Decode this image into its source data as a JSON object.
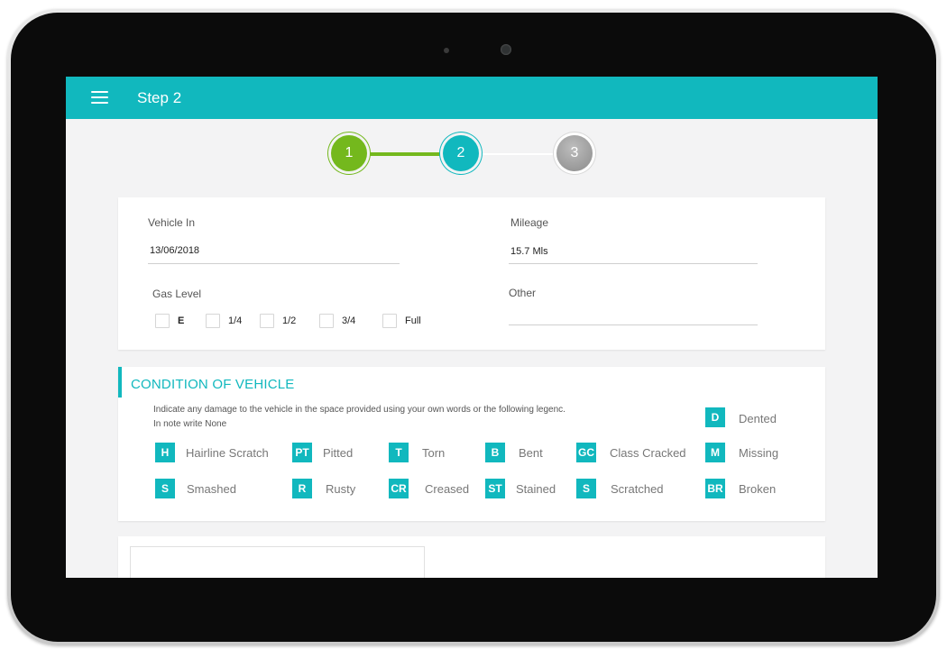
{
  "appbar": {
    "title": "Step 2",
    "menu_icon": "menu-icon"
  },
  "stepper": {
    "steps": [
      {
        "label": "1",
        "state": "completed"
      },
      {
        "label": "2",
        "state": "active"
      },
      {
        "label": "3",
        "state": "pending"
      }
    ]
  },
  "vehicle": {
    "vehicle_in_label": "Vehicle In",
    "vehicle_in_value": "13/06/2018",
    "mileage_label": "Mileage",
    "mileage_value": "15.7 Mls",
    "gas_level_label": "Gas Level",
    "gas_options": [
      "E",
      "1/4",
      "1/2",
      "3/4",
      "Full"
    ],
    "other_label": "Other",
    "other_value": ""
  },
  "condition": {
    "title": "CONDITION OF VEHICLE",
    "instruction_line1": "Indicate any damage to the vehicle in the space provided using your own words or the following legenc.",
    "instruction_line2": "In note write None",
    "legend": [
      {
        "code": "D",
        "label": "Dented"
      },
      {
        "code": "H",
        "label": "Hairline Scratch"
      },
      {
        "code": "PT",
        "label": "Pitted"
      },
      {
        "code": "T",
        "label": "Torn"
      },
      {
        "code": "B",
        "label": "Bent"
      },
      {
        "code": "GC",
        "label": "Class Cracked"
      },
      {
        "code": "M",
        "label": "Missing"
      },
      {
        "code": "S",
        "label": "Smashed"
      },
      {
        "code": "R",
        "label": "Rusty"
      },
      {
        "code": "CR",
        "label": "Creased"
      },
      {
        "code": "ST",
        "label": "Stained"
      },
      {
        "code": "S",
        "label": "Scratched"
      },
      {
        "code": "BR",
        "label": "Broken"
      }
    ]
  },
  "colors": {
    "accent": "#11b8be",
    "completed": "#74b81d",
    "pending": "#8b8b8b",
    "background": "#f3f3f4"
  }
}
